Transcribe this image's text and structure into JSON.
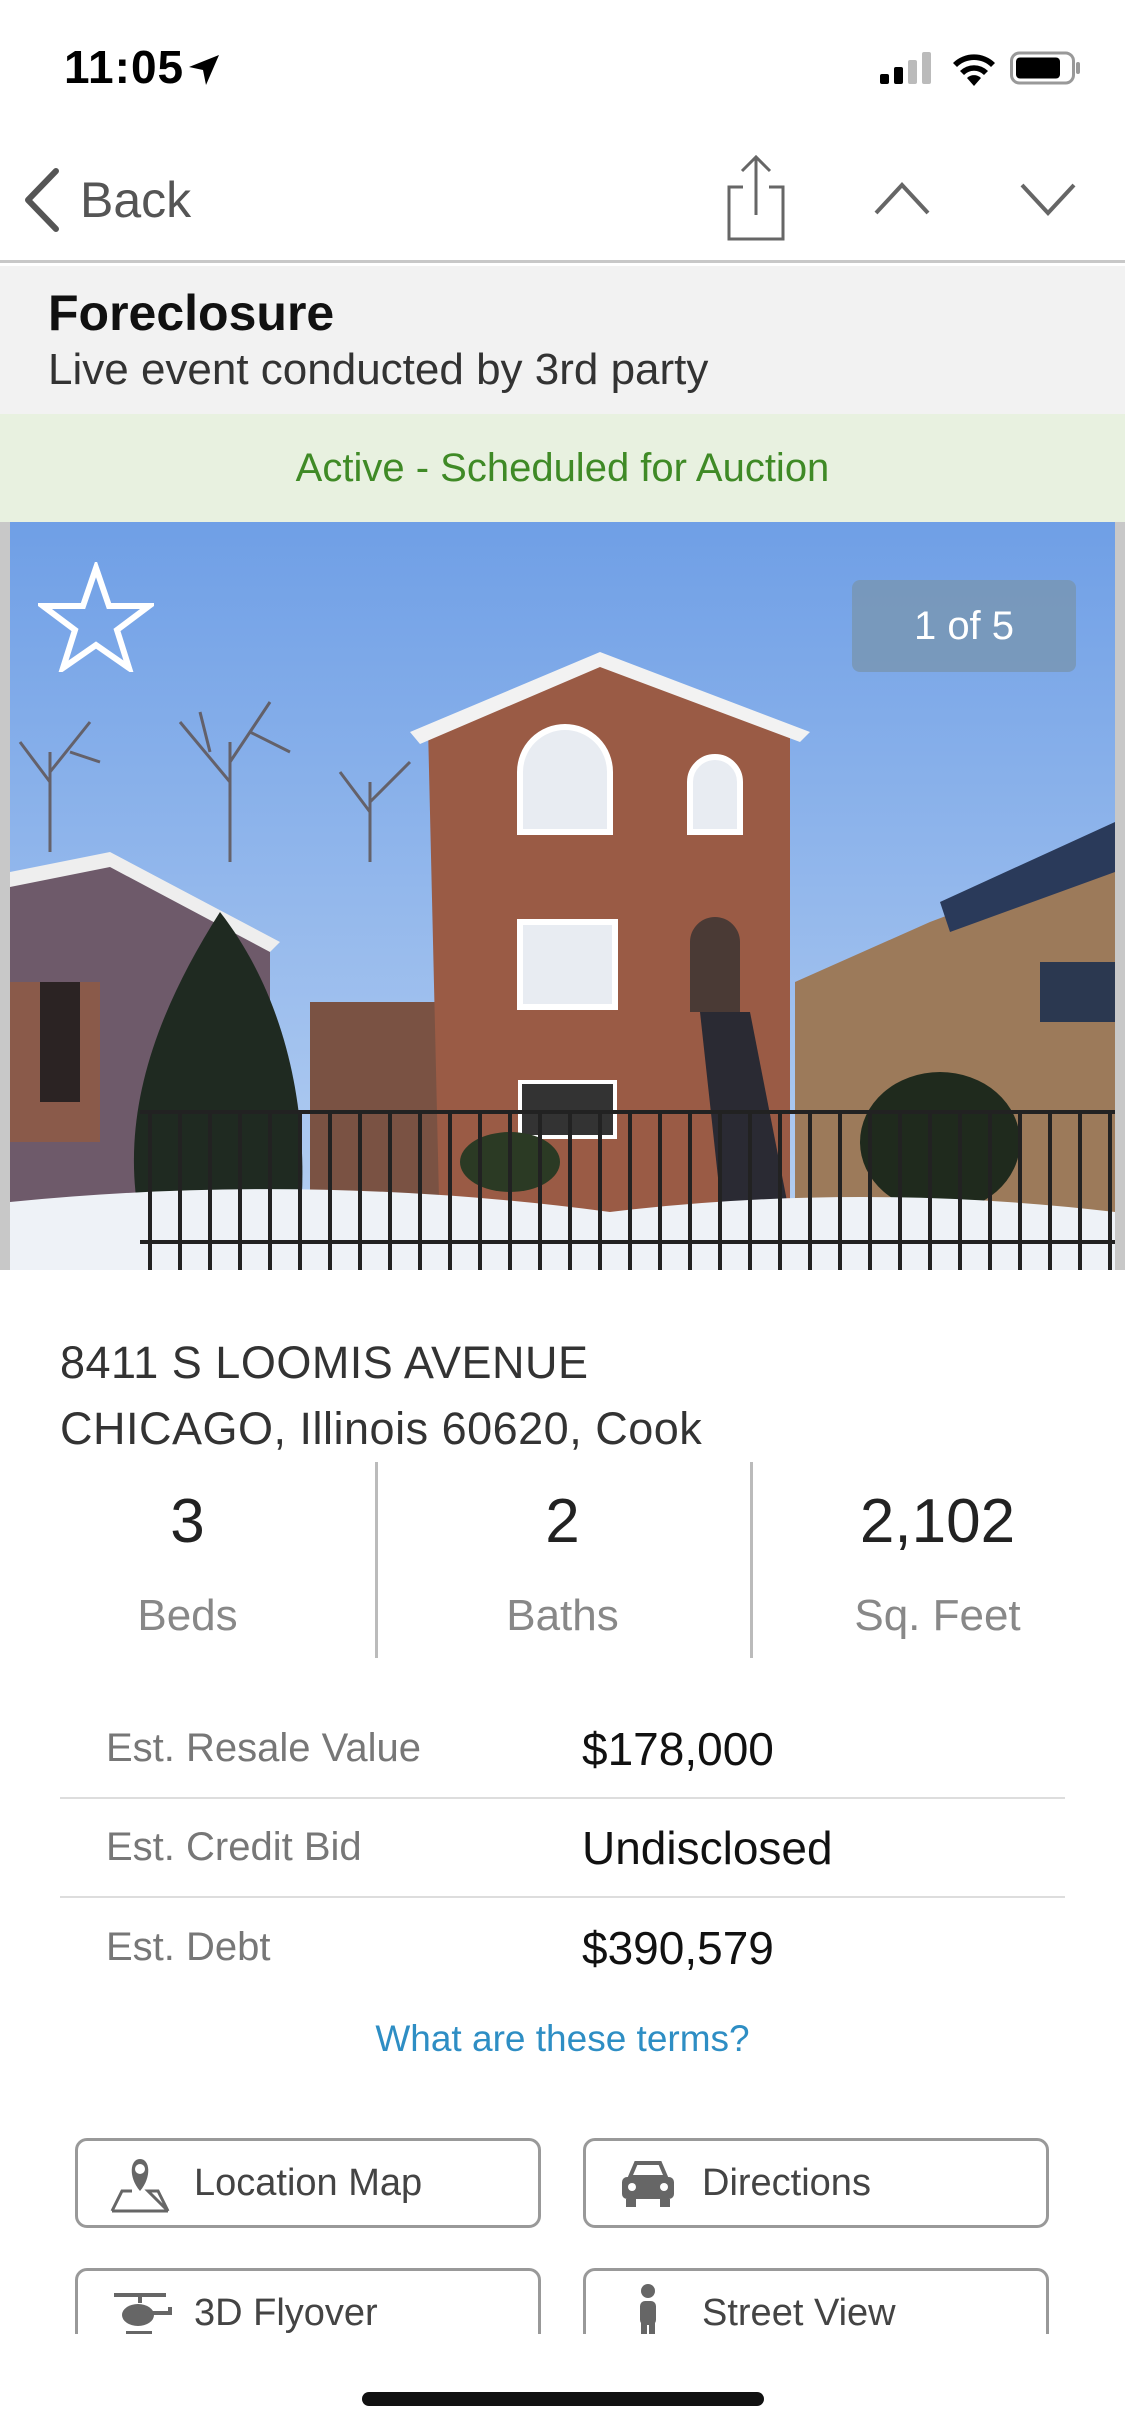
{
  "status_bar": {
    "time": "11:05"
  },
  "nav": {
    "back_label": "Back"
  },
  "header": {
    "sale_type": "Foreclosure",
    "subtitle": "Live event conducted by 3rd party",
    "status": "Active - Scheduled for Auction"
  },
  "photo": {
    "counter": "1 of 5"
  },
  "address": {
    "line1": "8411 S LOOMIS AVENUE",
    "line2": "CHICAGO, Illinois 60620, Cook"
  },
  "stats": [
    {
      "value": "3",
      "label": "Beds"
    },
    {
      "value": "2",
      "label": "Baths"
    },
    {
      "value": "2,102",
      "label": "Sq. Feet"
    }
  ],
  "values": [
    {
      "label": "Est. Resale Value",
      "amount": "$178,000"
    },
    {
      "label": "Est. Credit Bid",
      "amount": "Undisclosed"
    },
    {
      "label": "Est. Debt",
      "amount": "$390,579"
    }
  ],
  "terms_link": "What are these terms?",
  "actions": [
    {
      "label": "Location Map",
      "icon": "map-pin-icon"
    },
    {
      "label": "Directions",
      "icon": "car-icon"
    },
    {
      "label": "3D Flyover",
      "icon": "helicopter-icon"
    },
    {
      "label": "Street View",
      "icon": "person-icon"
    }
  ],
  "colors": {
    "status_green": "#3f8a26",
    "status_banner_bg": "#e8f1e0",
    "link_blue": "#2e8ec4",
    "counter_bg": "#7896b4"
  }
}
